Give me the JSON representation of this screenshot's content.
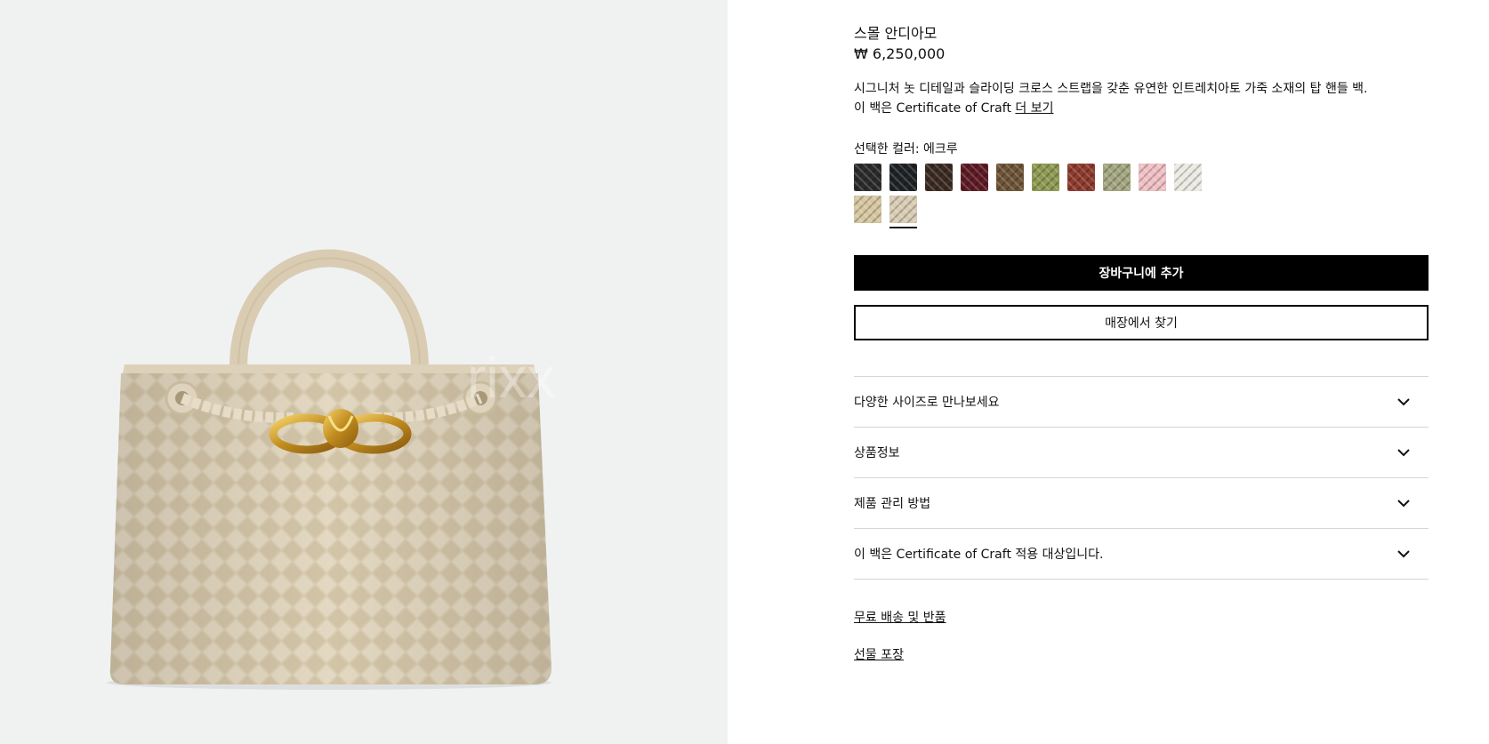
{
  "product": {
    "name": "스몰 안디아모",
    "price": "₩ 6,250,000",
    "description_line1": "시그니처 놋 디테일과 슬라이딩 크로스 스트랩을 갖춘 유연한 인트레치아토 가죽 소재의 탑 핸들 백.",
    "description_line2": "이 백은 Certificate of Craft",
    "more_link": "더 보기",
    "watermark": "rixx"
  },
  "color": {
    "selected_label": "선택한 컬러: 에크루",
    "swatches": [
      {
        "name": "black",
        "hex": "#2a2b2a"
      },
      {
        "name": "black-2",
        "hex": "#1f2224"
      },
      {
        "name": "fondant",
        "hex": "#3b2a22"
      },
      {
        "name": "barolo",
        "hex": "#5e1a24"
      },
      {
        "name": "acorn",
        "hex": "#6e5437"
      },
      {
        "name": "kiwi",
        "hex": "#8e9a52"
      },
      {
        "name": "rust",
        "hex": "#8e3a2c"
      },
      {
        "name": "travertine-green",
        "hex": "#a3a680"
      },
      {
        "name": "pink",
        "hex": "#f1c0c4"
      },
      {
        "name": "chalk",
        "hex": "#ecebe3"
      },
      {
        "name": "sand",
        "hex": "#d6c7a1"
      },
      {
        "name": "ecru",
        "hex": "#d8ccb4",
        "selected": true
      }
    ]
  },
  "actions": {
    "add_to_cart": "장바구니에 추가",
    "find_in_store": "매장에서 찾기"
  },
  "accordion": [
    {
      "label": "다양한 사이즈로 만나보세요"
    },
    {
      "label": "상품정보"
    },
    {
      "label": "제품 관리 방법"
    },
    {
      "label": "이 백은 Certificate of Craft 적용 대상입니다."
    }
  ],
  "links": {
    "shipping": "무료 배송 및 반품",
    "gift": "선물 포장"
  },
  "colors": {
    "image_bg": "#f0f2f2",
    "bag": "#dcd0b8",
    "hardware": "#c99a2e",
    "button_primary": "#000000"
  }
}
